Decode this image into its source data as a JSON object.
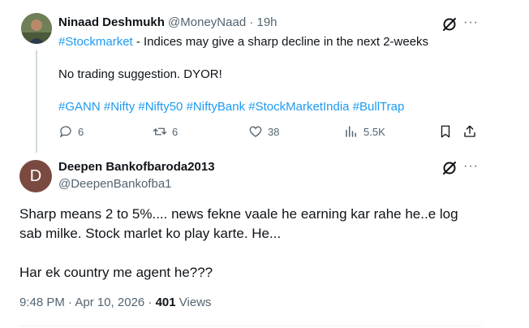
{
  "tweet1": {
    "author_name": "Ninaad Deshmukh",
    "handle": "@MoneyNaad",
    "separator": "·",
    "time": "19h",
    "hashtag_lead": "#Stockmarket",
    "text_line1": " - Indices may give a sharp decline in the next 2-weeks",
    "text_line2": "No trading suggestion. DYOR!",
    "hashtags": [
      "#GANN",
      "#Nifty",
      "#Nifty50",
      "#NiftyBank",
      "#StockMarketIndia",
      "#BullTrap"
    ],
    "replies": "6",
    "reposts": "6",
    "likes": "38",
    "views": "5.5K",
    "more": "···"
  },
  "tweet2": {
    "avatar_letter": "D",
    "author_name": "Deepen Bankofbaroda2013",
    "handle": "@DeepenBankofba1",
    "body_line1": "Sharp means  2 to 5%.... news fekne vaale he  earning kar rahe he..e log",
    "body_line2": "sab milke. Stock marlet ko play karte. He...",
    "body_line3": "Har ek country me agent he???",
    "timestamp": "9:48 PM · Apr 10, 2026 · ",
    "views_count": "401",
    "views_label": " Views",
    "more": "···"
  },
  "colors": {
    "link": "#1d9bf0",
    "muted": "#536471",
    "text": "#0f1419",
    "thread_line": "#cfd9de"
  }
}
